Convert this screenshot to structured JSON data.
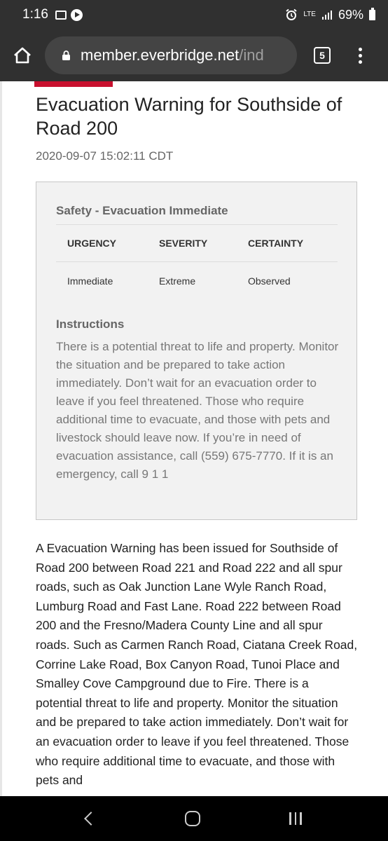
{
  "status_bar": {
    "time": "1:16",
    "network": "LTE",
    "battery": "69%",
    "icons": [
      "image-icon",
      "play-icon",
      "alarm-icon",
      "lte-icon",
      "signal-icon",
      "battery-icon"
    ]
  },
  "browser": {
    "url_host": "member.everbridge.net",
    "url_path": "/ind",
    "tab_count": "5"
  },
  "article": {
    "title": "Evacuation Warning for Southside of Road 200",
    "timestamp": "2020-09-07 15:02:11 CDT",
    "accent_color": "#c8102e",
    "card": {
      "category": "Safety - Evacuation Immediate",
      "headers": {
        "urgency": "URGENCY",
        "severity": "SEVERITY",
        "certainty": "CERTAINTY"
      },
      "values": {
        "urgency": "Immediate",
        "severity": "Extreme",
        "certainty": "Observed"
      },
      "instructions_label": "Instructions",
      "instructions_text": "There is a potential threat to life and property. Monitor the situation and be prepared to take action immediately. Don’t wait for an evacuation order to leave if you feel threatened. Those who require additional time to evacuate, and those with pets and livestock should leave now. If you’re in need of evacuation assistance, call (559) 675-7770. If it is an emergency, call 9 1 1"
    },
    "body": "A Evacuation Warning has been issued for Southside of Road 200 between Road 221 and Road 222 and all spur roads, such as Oak Junction Lane Wyle Ranch Road, Lumburg Road and Fast Lane. Road 222 between Road 200 and the Fresno/Madera County Line and all spur roads. Such as Carmen Ranch Road, Ciatana Creek Road, Corrine Lake Road, Box Canyon Road, Tunoi Place and Smalley Cove Campground due to Fire. There is a potential threat to life and property. Monitor the situation and be prepared to take action immediately. Don’t wait for an evacuation order to leave if you feel threatened. Those who require additional time to evacuate, and those with pets and"
  }
}
